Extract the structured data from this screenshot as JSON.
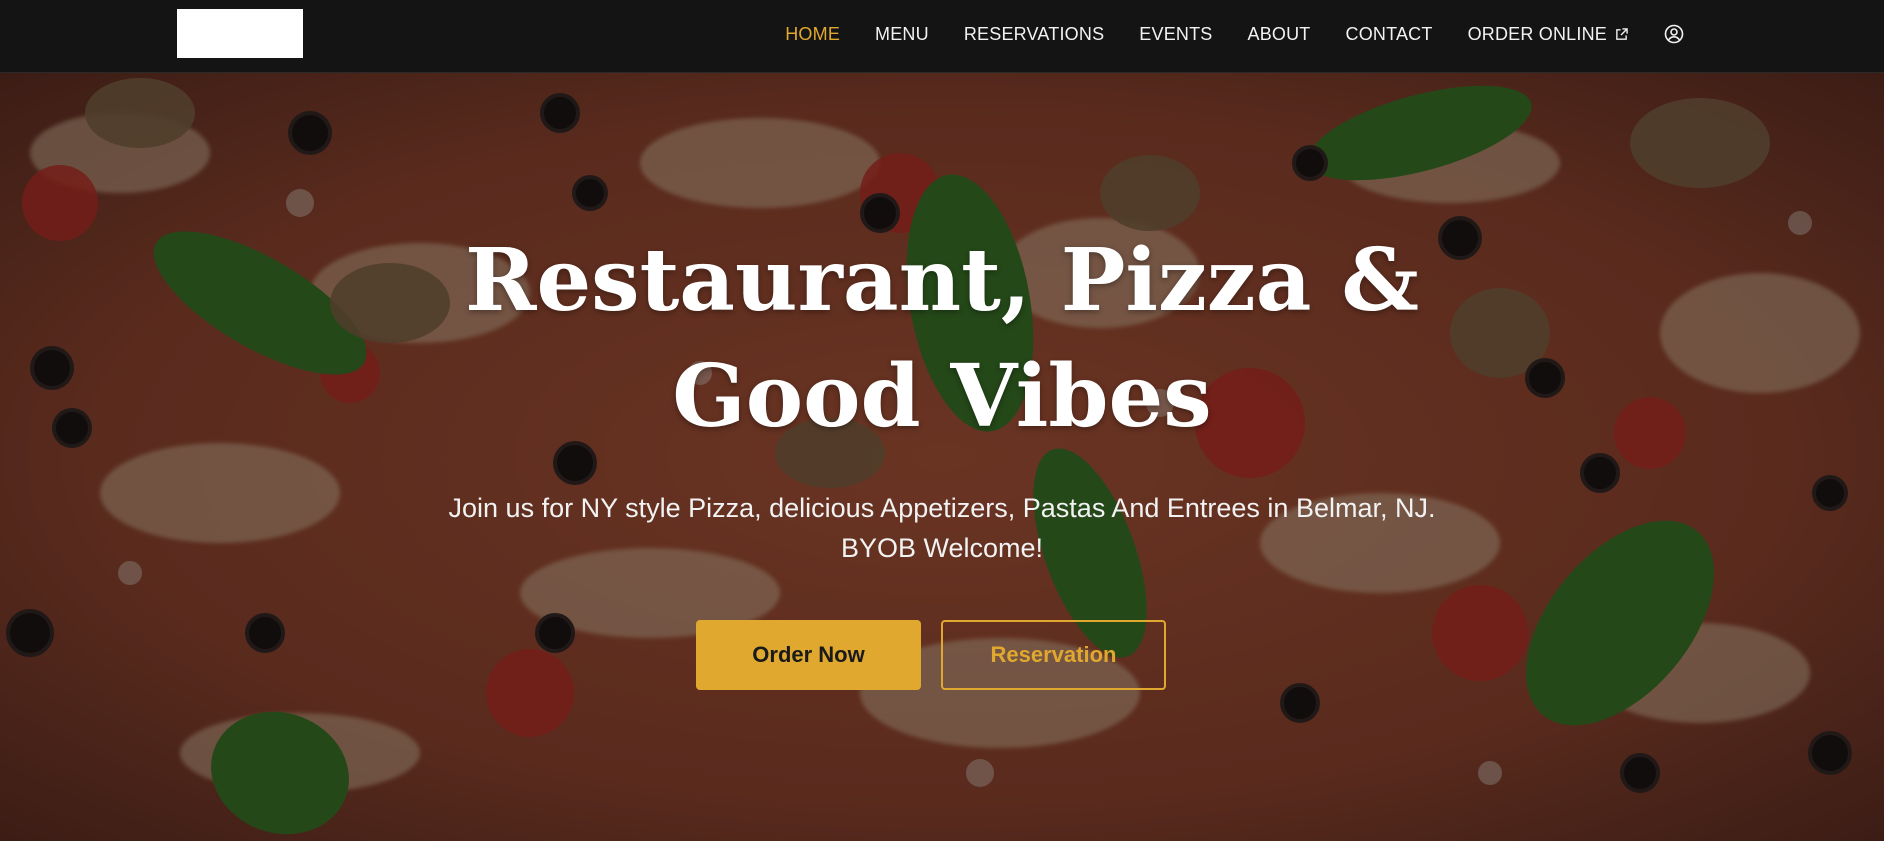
{
  "colors": {
    "accent": "#e0a82e",
    "nav_bg": "#141414",
    "text": "#ffffff"
  },
  "header": {
    "logo_alt": "",
    "nav": [
      {
        "label": "HOME",
        "active": true
      },
      {
        "label": "MENU"
      },
      {
        "label": "RESERVATIONS"
      },
      {
        "label": "EVENTS"
      },
      {
        "label": "ABOUT"
      },
      {
        "label": "CONTACT"
      },
      {
        "label": "ORDER ONLINE",
        "icon": "external-link-icon"
      }
    ],
    "account_icon": "user-circle-icon"
  },
  "hero": {
    "title_line1": "Restaurant, Pizza &",
    "title_line2": "Good Vibes",
    "subtitle_line1": "Join us for NY style Pizza, delicious Appetizers, Pastas And Entrees in Belmar, NJ.",
    "subtitle_line2": "BYOB Welcome!",
    "primary_button": "Order Now",
    "secondary_button": "Reservation",
    "background": "pizza-photo"
  }
}
